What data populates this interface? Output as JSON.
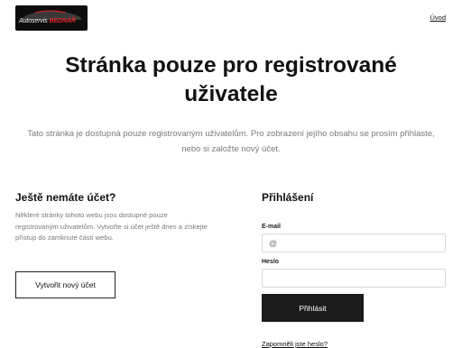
{
  "header": {
    "logo": {
      "part1": "Autoservis ",
      "part2": "BEDNÁŘ"
    },
    "nav": {
      "home_label": "Úvod"
    }
  },
  "main": {
    "title": "Stránka pouze pro registrované uživatele",
    "lead": "Tato stránka je dostupná pouze registrovaným uživatelům. Pro zobrazení jejího obsahu se prosím přihlaste, nebo si založte nový účet."
  },
  "signup": {
    "title": "Ještě nemáte účet?",
    "text": "Některé stránky tohoto webu jsou dostupné pouze registrovaným uživatelům. Vytvořte si účet ještě dnes a získejte přístup do zamknuté části webu.",
    "button_label": "Vytvořit nový účet"
  },
  "login": {
    "title": "Přihlášení",
    "email_label": "E-mail",
    "email_placeholder": "@",
    "password_label": "Heslo",
    "password_placeholder": "",
    "submit_label": "Přihlásit",
    "forgot_label": "Zapomněli jste heslo?"
  },
  "colors": {
    "brand_red": "#e3262b",
    "logo_bg": "#0d0d0d",
    "button_dark": "#1b1b1b",
    "muted_text": "#7a7a7a"
  }
}
